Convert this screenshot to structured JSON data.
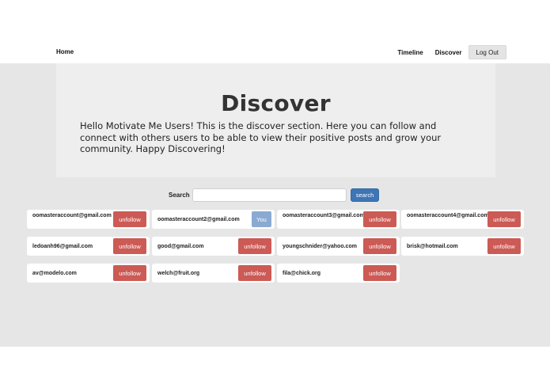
{
  "nav": {
    "home": "Home",
    "timeline": "Timeline",
    "discover": "Discover",
    "logout": "Log Out"
  },
  "hero": {
    "title": "Discover",
    "text": "Hello Motivate Me Users! This is the discover section. Here you can follow and connect with others users to be able to view their positive posts and grow your community. Happy Discovering!"
  },
  "search": {
    "label": "Search",
    "value": "",
    "placeholder": "",
    "button": "search"
  },
  "users": [
    {
      "email": "oomasteraccount@gmail.com",
      "action": "unfollow"
    },
    {
      "email": "oomasteraccount2@gmail.com",
      "action": "You"
    },
    {
      "email": "oomasteraccount3@gmail.com",
      "action": "unfollow"
    },
    {
      "email": "oomasteraccount4@gmail.com",
      "action": "unfollow"
    },
    {
      "email": "ledoanh96@gmail.com",
      "action": "unfollow"
    },
    {
      "email": "good@gmail.com",
      "action": "unfollow"
    },
    {
      "email": "youngschnider@yahoo.com",
      "action": "unfollow"
    },
    {
      "email": "brisk@hotmail.com",
      "action": "unfollow"
    },
    {
      "email": "av@modelo.com",
      "action": "unfollow"
    },
    {
      "email": "welch@fruit.org",
      "action": "unfollow"
    },
    {
      "email": "fila@chick.org",
      "action": "unfollow"
    }
  ],
  "colors": {
    "unfollow": "#cc5a55",
    "you": "#8aaad2",
    "search_button": "#3d75b6",
    "content_bg": "#e6e6e6"
  }
}
